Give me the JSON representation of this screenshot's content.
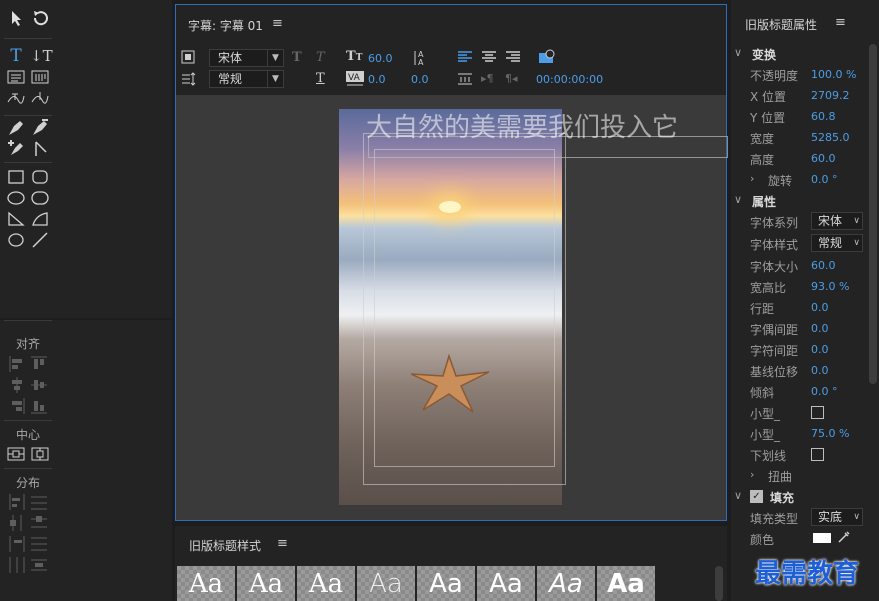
{
  "editor": {
    "title": "字幕: 字幕 01",
    "menu_icon": "≡"
  },
  "toolbar": {
    "font_family": "宋体",
    "font_style": "常规",
    "font_size": "60.0",
    "kerning": "0.0",
    "leading": "0.0",
    "timecode": "00:00:00:00"
  },
  "canvas": {
    "text": "大自然的美需要我们投入它"
  },
  "styles_panel": {
    "title": "旧版标题样式",
    "menu_icon": "≡",
    "swatches": [
      "Aa",
      "Aa",
      "Aa",
      "Aa",
      "Aa",
      "Aa",
      "Aa",
      "Aa"
    ]
  },
  "props": {
    "title": "旧版标题属性",
    "menu_icon": "≡",
    "transform": {
      "label": "变换",
      "opacity_label": "不透明度",
      "opacity": "100.0 %",
      "x_label": "X 位置",
      "x": "2709.2",
      "y_label": "Y 位置",
      "y": "60.8",
      "width_label": "宽度",
      "width": "5285.0",
      "height_label": "高度",
      "height": "60.0",
      "rotation_label": "旋转",
      "rotation": "0.0 °"
    },
    "attributes": {
      "label": "属性",
      "font_family_label": "字体系列",
      "font_family": "宋体",
      "font_style_label": "字体样式",
      "font_style": "常规",
      "font_size_label": "字体大小",
      "font_size": "60.0",
      "aspect_label": "宽高比",
      "aspect": "93.0 %",
      "leading_label": "行距",
      "leading": "0.0",
      "kerning_label": "字偶间距",
      "kerning": "0.0",
      "tracking_label": "字符间距",
      "tracking": "0.0",
      "baseline_label": "基线位移",
      "baseline": "0.0",
      "slant_label": "倾斜",
      "slant": "0.0 °",
      "smallcaps_label": "小型_",
      "smallcaps_size_label": "小型_",
      "smallcaps_size": "75.0 %",
      "underline_label": "下划线",
      "distort_label": "扭曲"
    },
    "fill": {
      "label": "填充",
      "type_label": "填充类型",
      "type": "实底",
      "color_label": "颜色",
      "color": "#ffffff"
    }
  },
  "align_panel": {
    "align_label": "对齐",
    "center_label": "中心",
    "distribute_label": "分布"
  },
  "watermark": "最需教育"
}
